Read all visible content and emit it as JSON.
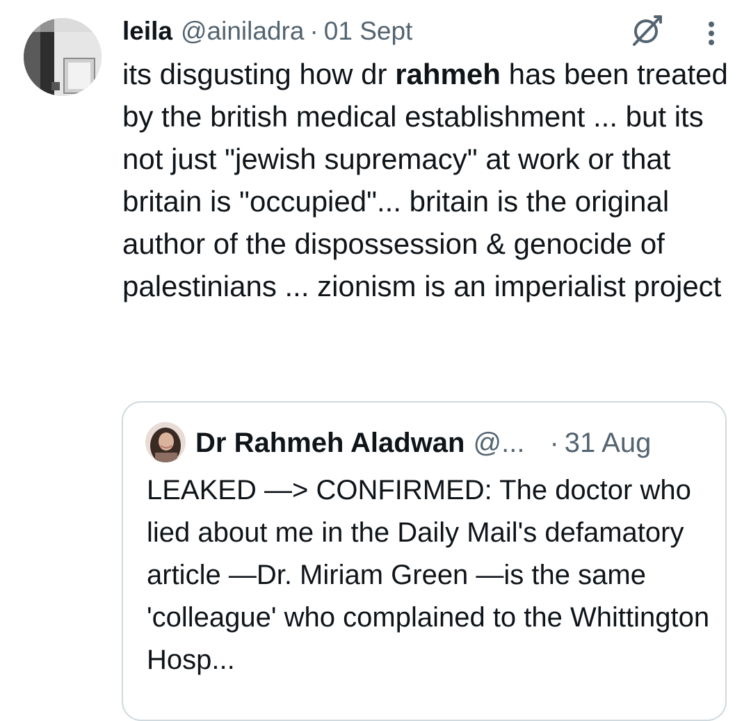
{
  "tweet": {
    "author": {
      "display_name": "leila",
      "handle": "@ainiladra"
    },
    "separator": "·",
    "date": "01 Sept",
    "text_segments": {
      "s1": "its disgusting how dr ",
      "bold": "rahmeh",
      "s2": " has been treated by the british medical establishment ... but its not just \"jewish supremacy\" at work or that britain is \"occupied\"... britain is the original author of the dispossession & genocide of palestinians ... zionism is an imperialist project"
    },
    "icons": {
      "grok": "grok-icon",
      "more": "more-vertical-icon",
      "avatar": "avatar-photo"
    }
  },
  "quote": {
    "author": {
      "display_name": "Dr Rahmeh Aladwan",
      "handle": "@..."
    },
    "separator": "·",
    "date": "31 Aug",
    "text": "LEAKED —> CONFIRMED: The doctor who lied about me in the Daily Mail's defamatory article —Dr. Miriam Green —is the same 'colleague' who complained to the Whittington Hosp..."
  },
  "colors": {
    "text_primary": "#0f1419",
    "text_secondary": "#536471",
    "border": "#cfd9de"
  }
}
